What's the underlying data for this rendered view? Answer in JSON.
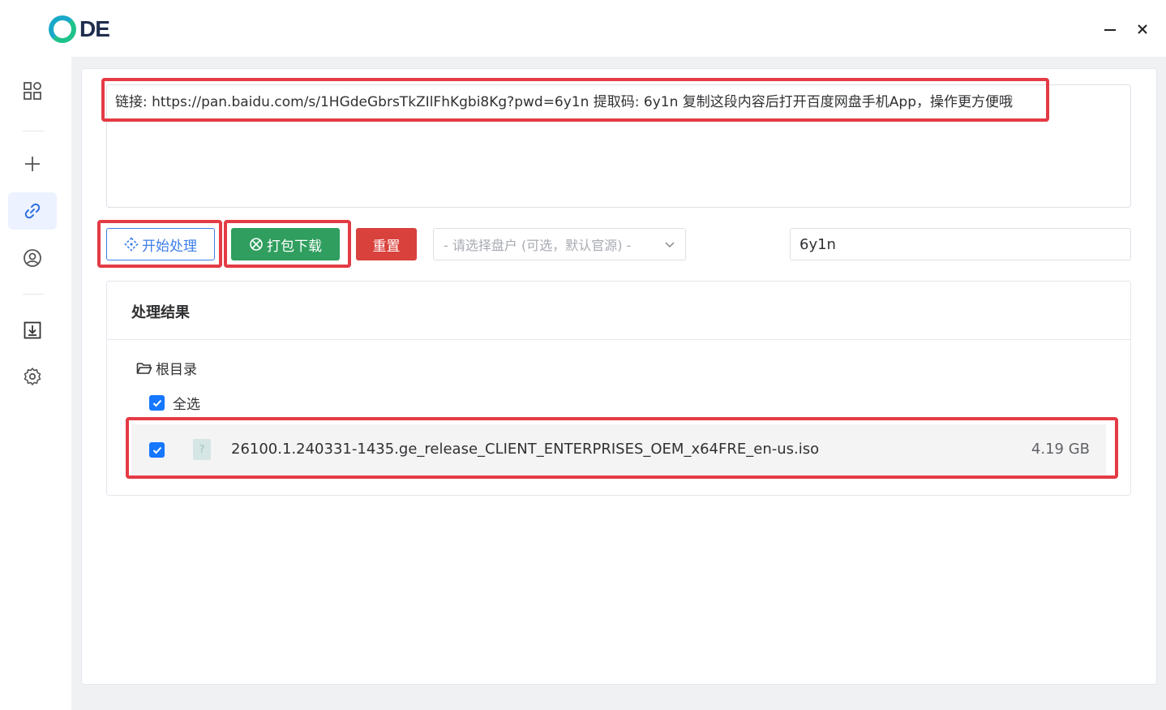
{
  "app": {
    "logo_text": "DE",
    "minimize_glyph": "—",
    "close_glyph": "✕"
  },
  "sidebar": {
    "items": [
      {
        "name": "dashboard-icon",
        "active": false
      },
      {
        "name": "plus-icon",
        "active": false
      },
      {
        "name": "link-icon",
        "active": true
      },
      {
        "name": "user-circle-icon",
        "active": false
      },
      {
        "name": "download-icon",
        "active": false
      },
      {
        "name": "gear-icon",
        "active": false
      }
    ]
  },
  "link_input": {
    "value": "链接: https://pan.baidu.com/s/1HGdeGbrsTkZIlFhKgbi8Kg?pwd=6y1n 提取码: 6y1n 复制这段内容后打开百度网盘手机App，操作更方便哦"
  },
  "toolbar": {
    "start_label": "开始处理",
    "pack_label": "打包下载",
    "reset_label": "重置",
    "disk_select_placeholder": "- 请选择盘户 (可选，默认官源) -",
    "code_value": "6y1n"
  },
  "result": {
    "title": "处理结果",
    "root_label": "根目录",
    "select_all_label": "全选",
    "select_all_checked": true,
    "files": [
      {
        "name": "26100.1.240331-1435.ge_release_CLIENT_ENTERPRISES_OEM_x64FRE_en-us.iso",
        "size": "4.19 GB",
        "checked": true,
        "icon": "file-unknown-icon"
      }
    ]
  },
  "colors": {
    "primary": "#3d7ee8",
    "success": "#2f9e5e",
    "danger": "#d9413c",
    "highlight": "#e43b45",
    "checkbox": "#1677ff"
  }
}
